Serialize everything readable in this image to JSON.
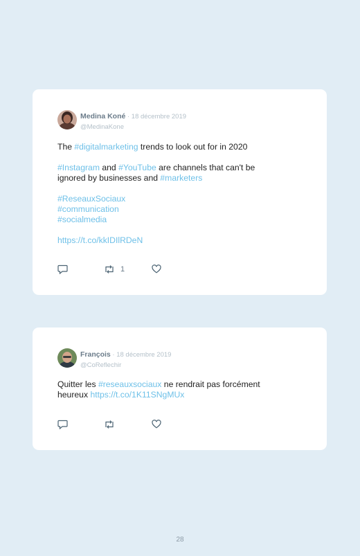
{
  "tweets": [
    {
      "name": "Medina Koné",
      "date": " · 18 décembre 2019",
      "handle": "@MedinaKone",
      "l1a": "The ",
      "l1b": "#digitalmarketing",
      "l1c": " trends to look out for in 2020",
      "l2a": "#Instagram",
      "l2b": " and ",
      "l2c": "#YouTube",
      "l2d": " are channels that can't be",
      "l3a": "ignored by businesses and ",
      "l3b": "#marketers",
      "t1": "#ReseauxSociaux",
      "t2": "#communication",
      "t3": "#socialmedia",
      "link": "https://t.co/kkIDIlRDeN",
      "retweet_count": "1"
    },
    {
      "name": "François",
      "date": " · 18 décembre 2019",
      "handle": "@CoReflechir",
      "l1a": "Quitter les ",
      "l1b": "#reseauxsociaux",
      "l1c": " ne rendrait pas forcément",
      "l2a": "heureux ",
      "l2b": "https://t.co/1K11SNgMUx"
    }
  ],
  "page_number": "28",
  "colors": {
    "background": "#e1edf5",
    "hashtag": "#6ec0e8",
    "meta": "#b4c0c9",
    "name": "#6b7c8a"
  }
}
